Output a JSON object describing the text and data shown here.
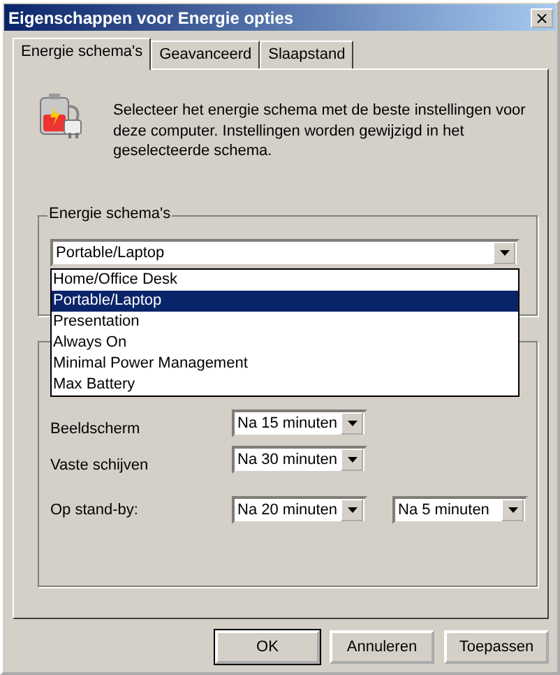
{
  "window": {
    "title": "Eigenschappen voor Energie opties",
    "close": "×"
  },
  "tabs": [
    {
      "label": "Energie schema's",
      "selected": true
    },
    {
      "label": "Geavanceerd",
      "selected": false
    },
    {
      "label": "Slaapstand",
      "selected": false
    }
  ],
  "intro": "Selecteer het energie schema met de beste instellingen voor deze computer. Instellingen worden gewijzigd in het geselecteerde schema.",
  "schemes": {
    "label": "Energie schema's",
    "value": "Portable/Laptop",
    "expanded": true,
    "options": [
      {
        "label": "Home/Office Desk",
        "selected": false
      },
      {
        "label": "Portable/Laptop",
        "selected": true
      },
      {
        "label": "Presentation",
        "selected": false
      },
      {
        "label": "Always On",
        "selected": false
      },
      {
        "label": "Minimal Power Management",
        "selected": false
      },
      {
        "label": "Max Battery",
        "selected": false
      }
    ]
  },
  "settings": [
    {
      "label": "Beeldscherm",
      "values": [
        "Na 15 minuten"
      ]
    },
    {
      "label": "Vaste schijven",
      "values": [
        "Na 30 minuten"
      ]
    },
    {
      "label": "Op stand-by:",
      "values": [
        "Na 20 minuten",
        "Na 5 minuten"
      ]
    }
  ],
  "buttons": [
    {
      "label": "OK",
      "default": true
    },
    {
      "label": "Annuleren",
      "default": false
    },
    {
      "label": "Toepassen",
      "default": false
    }
  ]
}
